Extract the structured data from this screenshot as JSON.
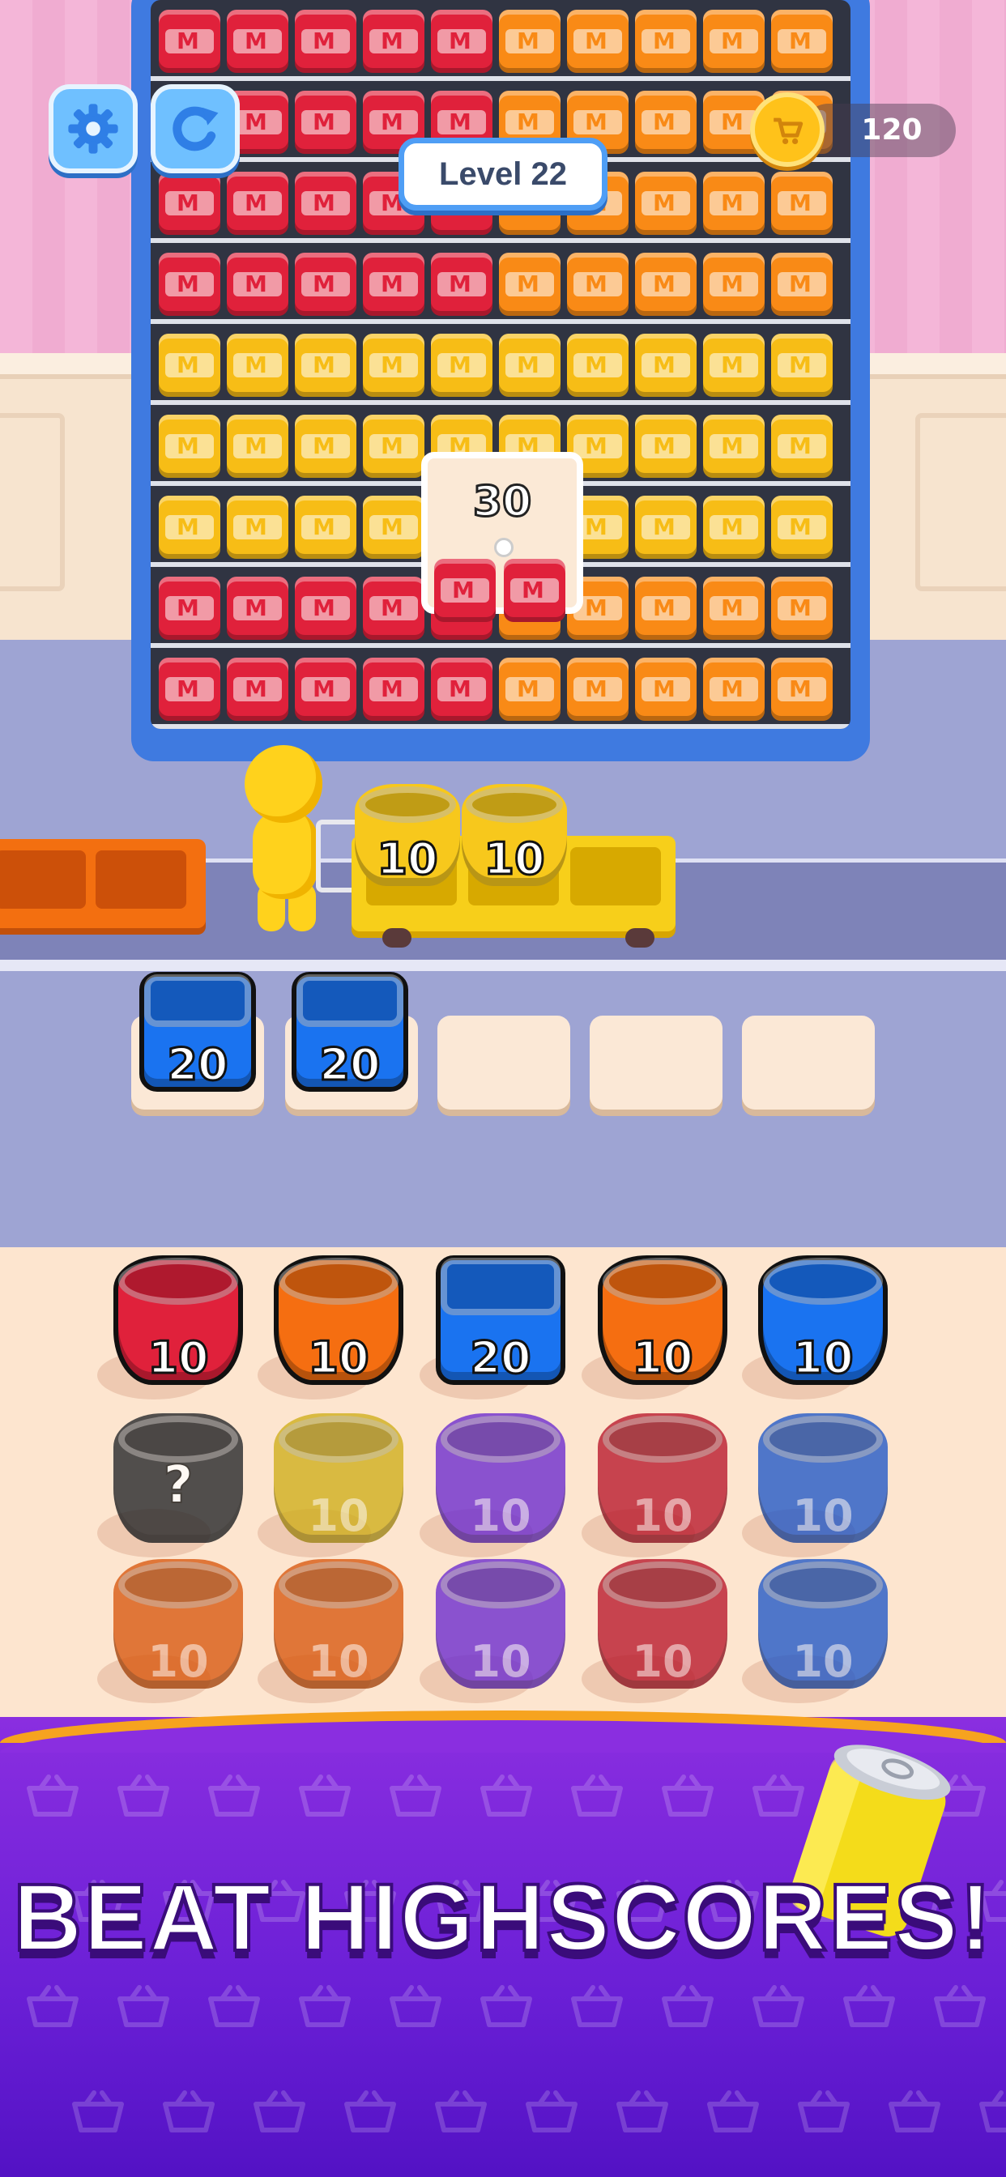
{
  "hud": {
    "settings_icon": "gear-icon",
    "restart_icon": "restart-icon",
    "coins": "120",
    "coin_icon": "cart-coin-icon",
    "level_label": "Level 22"
  },
  "order_card": {
    "count": "30"
  },
  "cart_baskets": [
    {
      "count": "10",
      "color": "#f7c81c"
    },
    {
      "count": "10",
      "color": "#f7c81c"
    }
  ],
  "queue": {
    "filled": [
      {
        "count": "20",
        "color": "#1a73f0"
      },
      {
        "count": "20",
        "color": "#1a73f0"
      }
    ],
    "empty_slots": 3
  },
  "collection": {
    "row1": [
      {
        "count": "10",
        "color": "#e0213b",
        "shape": "round"
      },
      {
        "count": "10",
        "color": "#f56e11",
        "shape": "round"
      },
      {
        "count": "20",
        "color": "#1a73f0",
        "shape": "square"
      },
      {
        "count": "10",
        "color": "#f56e11",
        "shape": "round"
      },
      {
        "count": "10",
        "color": "#1a73f0",
        "shape": "round"
      }
    ],
    "row2": [
      {
        "count": "",
        "color": "#222428",
        "shape": "mystery"
      },
      {
        "count": "10",
        "color": "#cfae1a",
        "shape": "round"
      },
      {
        "count": "10",
        "color": "#6a2ad0",
        "shape": "round"
      },
      {
        "count": "10",
        "color": "#b8162a",
        "shape": "round"
      },
      {
        "count": "10",
        "color": "#1f57c8",
        "shape": "round"
      }
    ],
    "row3": [
      {
        "count": "10",
        "color": "#d9580e",
        "shape": "round"
      },
      {
        "count": "10",
        "color": "#d9580e",
        "shape": "round"
      },
      {
        "count": "10",
        "color": "#6a2ad0",
        "shape": "round"
      },
      {
        "count": "10",
        "color": "#b8162a",
        "shape": "round"
      },
      {
        "count": "10",
        "color": "#1f57c8",
        "shape": "round"
      }
    ]
  },
  "shelf_rows": [
    [
      "red",
      "red",
      "red",
      "red",
      "red",
      "orange",
      "orange",
      "orange",
      "orange",
      "orange"
    ],
    [
      "red",
      "red",
      "red",
      "red",
      "red",
      "orange",
      "orange",
      "orange",
      "orange",
      "orange"
    ],
    [
      "red",
      "red",
      "red",
      "red",
      "red",
      "orange",
      "orange",
      "orange",
      "orange",
      "orange"
    ],
    [
      "red",
      "red",
      "red",
      "red",
      "red",
      "orange",
      "orange",
      "orange",
      "orange",
      "orange"
    ],
    [
      "yellow",
      "yellow",
      "yellow",
      "yellow",
      "yellow",
      "yellow",
      "yellow",
      "yellow",
      "yellow",
      "yellow"
    ],
    [
      "yellow",
      "yellow",
      "yellow",
      "yellow",
      "yellow",
      "yellow",
      "yellow",
      "yellow",
      "yellow",
      "yellow"
    ],
    [
      "yellow",
      "yellow",
      "yellow",
      "yellow",
      "yellow",
      "yellow",
      "yellow",
      "yellow",
      "yellow",
      "yellow"
    ],
    [
      "red",
      "red",
      "red",
      "red",
      "red",
      "orange",
      "orange",
      "orange",
      "orange",
      "orange"
    ],
    [
      "red",
      "red",
      "red",
      "red",
      "red",
      "orange",
      "orange",
      "orange",
      "orange",
      "orange"
    ]
  ],
  "banner": {
    "text": "BEAT HIGHSCORES!"
  },
  "colors": {
    "shelf_frame": "#3f7ae0",
    "banner_purple": "#6a1fd6",
    "banner_trim": "#f6a31f",
    "hud_button": "#6fc0ff"
  }
}
